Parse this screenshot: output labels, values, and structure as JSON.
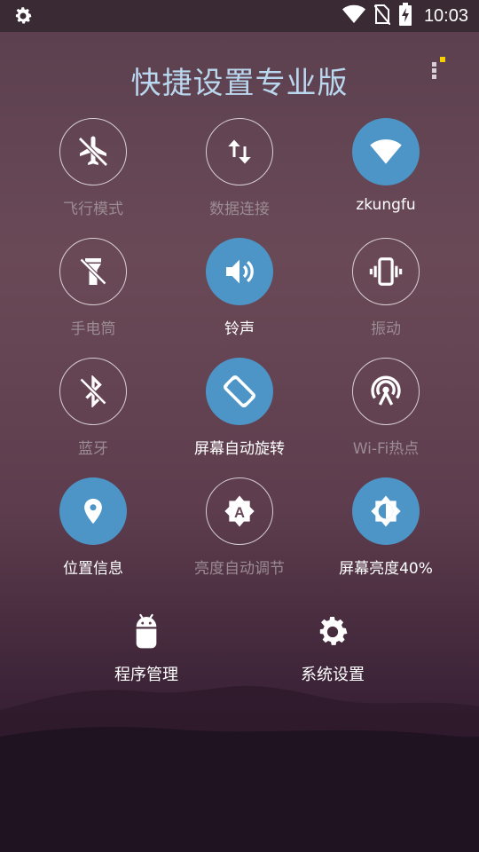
{
  "status_bar": {
    "time": "10:03",
    "left_icon": "gear-icon",
    "right_icons": [
      "wifi-signal-icon",
      "no-sim-icon",
      "battery-charging-icon"
    ]
  },
  "app": {
    "title": "快捷设置专业版",
    "menu_icon": "more-vertical-icon",
    "accent_color": "#4d95c7",
    "notification_dot_color": "#f5d000"
  },
  "tiles": [
    {
      "label": "飞行模式",
      "icon": "airplane-off-icon",
      "state": "off"
    },
    {
      "label": "数据连接",
      "icon": "data-transfer-icon",
      "state": "off"
    },
    {
      "label": "zkungfu",
      "icon": "wifi-icon",
      "state": "on"
    },
    {
      "label": "手电筒",
      "icon": "flashlight-off-icon",
      "state": "off"
    },
    {
      "label": "铃声",
      "icon": "volume-icon",
      "state": "on"
    },
    {
      "label": "振动",
      "icon": "vibrate-icon",
      "state": "off"
    },
    {
      "label": "蓝牙",
      "icon": "bluetooth-off-icon",
      "state": "off"
    },
    {
      "label": "屏幕自动旋转",
      "icon": "screen-rotation-icon",
      "state": "on"
    },
    {
      "label": "Wi-Fi热点",
      "icon": "hotspot-icon",
      "state": "off"
    },
    {
      "label": "位置信息",
      "icon": "location-icon",
      "state": "on"
    },
    {
      "label": "亮度自动调节",
      "icon": "auto-brightness-icon",
      "state": "off"
    },
    {
      "label": "屏幕亮度40%",
      "icon": "brightness-icon",
      "state": "on"
    }
  ],
  "bottom_buttons": [
    {
      "label": "程序管理",
      "icon": "android-icon"
    },
    {
      "label": "系统设置",
      "icon": "gear-icon"
    }
  ]
}
